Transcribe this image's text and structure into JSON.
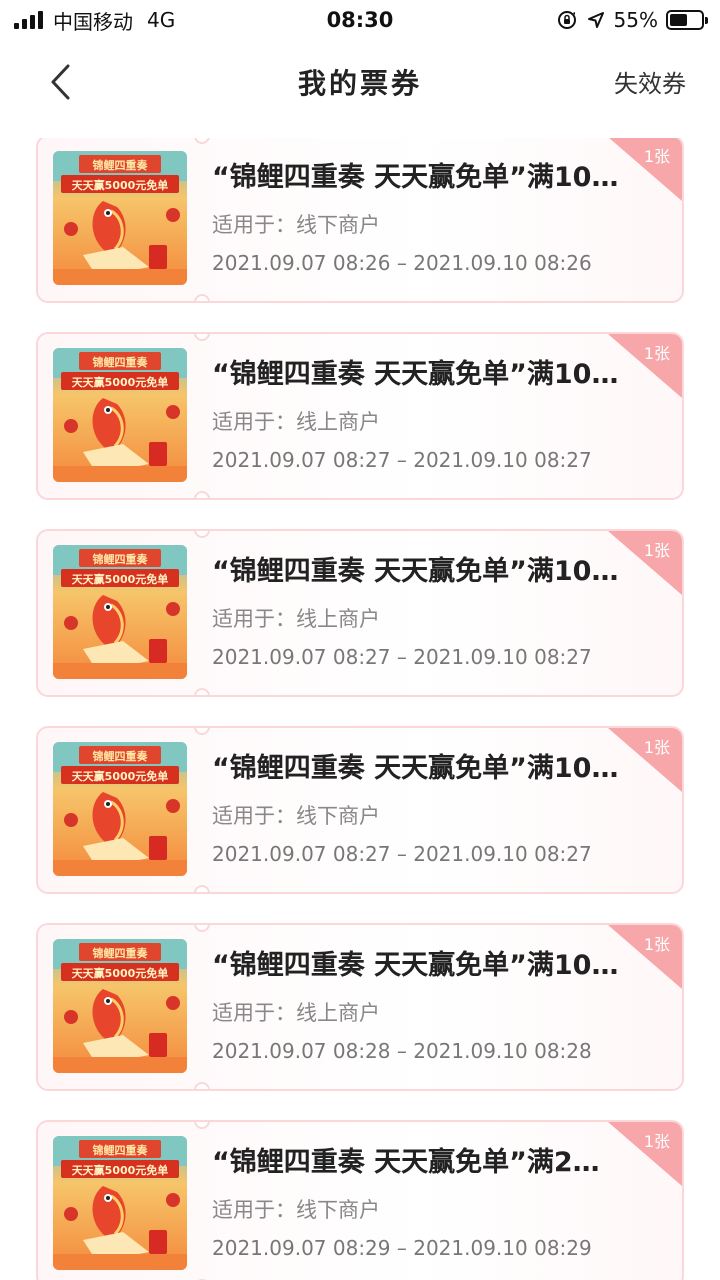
{
  "status_bar": {
    "carrier": "中国移动",
    "network": "4G",
    "time": "08:30",
    "battery_percent": "55%",
    "battery_level": 0.55,
    "icons": [
      "signal-icon",
      "orientation-lock-icon",
      "location-icon",
      "battery-icon"
    ]
  },
  "header": {
    "title": "我的票券",
    "back_icon": "chevron-left-icon",
    "expired_label": "失效券"
  },
  "coupon_image": {
    "banner_top": "锦鲤四重奏",
    "banner_main": "天天赢5000元免单"
  },
  "colors": {
    "card_border": "#fbd7da",
    "badge": "#f7a7a9",
    "accent": "#e8452d"
  },
  "coupons": [
    {
      "title": "“锦鲤四重奏 天天赢免单”满10…",
      "scope": "适用于：线下商户",
      "dates": "2021.09.07 08:26 – 2021.09.10 08:26",
      "count": "1张"
    },
    {
      "title": "“锦鲤四重奏 天天赢免单”满10…",
      "scope": "适用于：线上商户",
      "dates": "2021.09.07 08:27 – 2021.09.10 08:27",
      "count": "1张"
    },
    {
      "title": "“锦鲤四重奏 天天赢免单”满10…",
      "scope": "适用于：线上商户",
      "dates": "2021.09.07 08:27 – 2021.09.10 08:27",
      "count": "1张"
    },
    {
      "title": "“锦鲤四重奏 天天赢免单”满10…",
      "scope": "适用于：线下商户",
      "dates": "2021.09.07 08:27 – 2021.09.10 08:27",
      "count": "1张"
    },
    {
      "title": "“锦鲤四重奏 天天赢免单”满10…",
      "scope": "适用于：线上商户",
      "dates": "2021.09.07 08:28 – 2021.09.10 08:28",
      "count": "1张"
    },
    {
      "title": "“锦鲤四重奏 天天赢免单”满2…",
      "scope": "适用于：线下商户",
      "dates": "2021.09.07 08:29 – 2021.09.10 08:29",
      "count": "1张"
    }
  ]
}
